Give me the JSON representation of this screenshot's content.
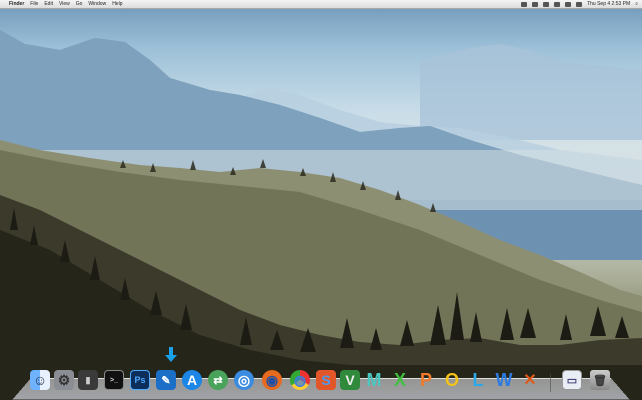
{
  "menubar": {
    "apple": "",
    "app": "Finder",
    "menus": [
      "File",
      "Edit",
      "View",
      "Go",
      "Window",
      "Help"
    ],
    "clock": "Thu Sep 4  2:53 PM",
    "status_icons": [
      "wifi-icon",
      "volume-icon",
      "battery-icon",
      "bluetooth-icon",
      "time-machine-icon",
      "sync-icon"
    ]
  },
  "dock": {
    "items": [
      {
        "name": "finder-icon",
        "glyph": "☺"
      },
      {
        "name": "system-preferences-icon",
        "glyph": "⚙"
      },
      {
        "name": "audio-icon",
        "glyph": "▮"
      },
      {
        "name": "terminal-icon",
        "glyph": ">_"
      },
      {
        "name": "photoshop-icon",
        "glyph": "Ps"
      },
      {
        "name": "xcode-icon",
        "glyph": "✎"
      },
      {
        "name": "app-store-icon",
        "glyph": "A"
      },
      {
        "name": "transmit-icon",
        "glyph": "⇄"
      },
      {
        "name": "safari-icon",
        "glyph": "◎"
      },
      {
        "name": "firefox-icon",
        "glyph": "◉"
      },
      {
        "name": "chrome-icon",
        "glyph": "◍"
      },
      {
        "name": "sublime-icon",
        "glyph": "S"
      },
      {
        "name": "vim-icon",
        "glyph": "V"
      },
      {
        "name": "m-icon",
        "glyph": "M"
      },
      {
        "name": "excel-icon",
        "glyph": "X"
      },
      {
        "name": "powerpoint-icon",
        "glyph": "P"
      },
      {
        "name": "outlook-icon",
        "glyph": "O"
      },
      {
        "name": "lync-icon",
        "glyph": "L"
      },
      {
        "name": "word-icon",
        "glyph": "W"
      },
      {
        "name": "tools-icon",
        "glyph": "✕"
      },
      {
        "name": "preview-icon",
        "glyph": "▭"
      },
      {
        "name": "trash-icon",
        "glyph": "🗑"
      }
    ]
  },
  "colors": {
    "sky_top": "#6f97b8",
    "mist": "#d9e3e6",
    "forest": "#2a2a1e",
    "dock_shelf": "#c8ccd6"
  }
}
